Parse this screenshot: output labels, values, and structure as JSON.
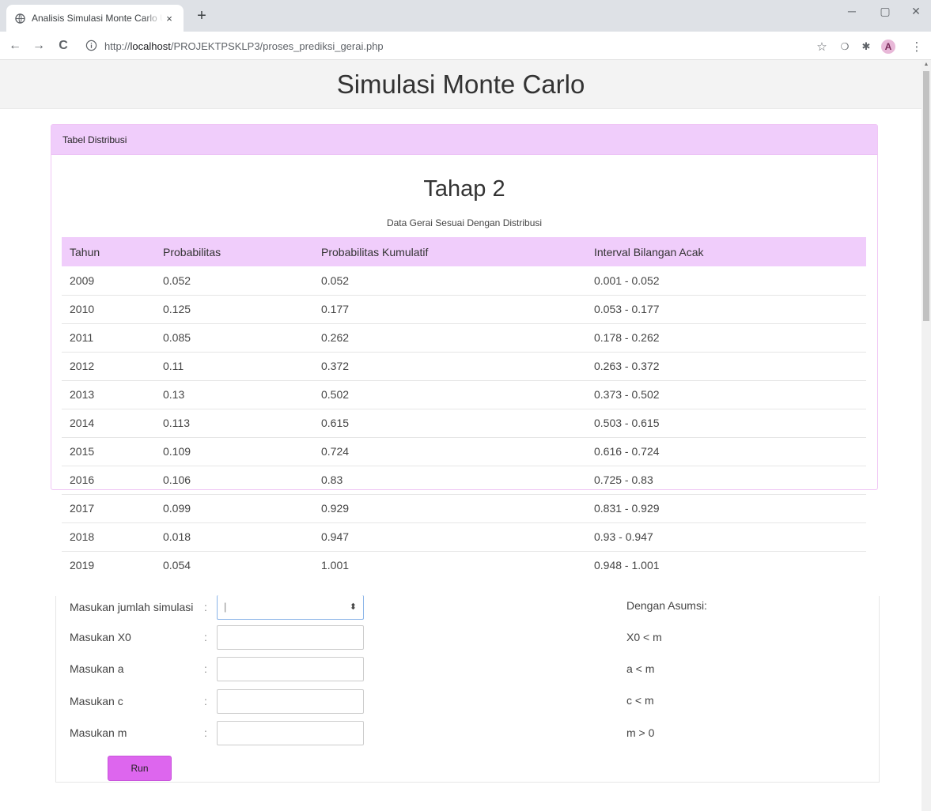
{
  "browser": {
    "tab_title": "Analisis Simulasi Monte Carlo Un",
    "url_prefix": "http://",
    "url_host": "localhost",
    "url_path": "/PROJEKTPSKLP3/proses_prediksi_gerai.php"
  },
  "header": {
    "title": "Simulasi Monte Carlo"
  },
  "card": {
    "header": "Tabel Distribusi"
  },
  "stage": {
    "title": "Tahap 2",
    "subtitle": "Data Gerai Sesuai Dengan Distribusi"
  },
  "table": {
    "columns": [
      "Tahun",
      "Probabilitas",
      "Probabilitas Kumulatif",
      "Interval Bilangan Acak"
    ],
    "rows": [
      [
        "2009",
        "0.052",
        "0.052",
        "0.001 - 0.052"
      ],
      [
        "2010",
        "0.125",
        "0.177",
        "0.053 - 0.177"
      ],
      [
        "2011",
        "0.085",
        "0.262",
        "0.178 - 0.262"
      ],
      [
        "2012",
        "0.11",
        "0.372",
        "0.263 - 0.372"
      ],
      [
        "2013",
        "0.13",
        "0.502",
        "0.373 - 0.502"
      ],
      [
        "2014",
        "0.113",
        "0.615",
        "0.503 - 0.615"
      ],
      [
        "2015",
        "0.109",
        "0.724",
        "0.616 - 0.724"
      ],
      [
        "2016",
        "0.106",
        "0.83",
        "0.725 - 0.83"
      ],
      [
        "2017",
        "0.099",
        "0.929",
        "0.831 - 0.929"
      ],
      [
        "2018",
        "0.018",
        "0.947",
        "0.93 - 0.947"
      ],
      [
        "2019",
        "0.054",
        "1.001",
        "0.948 - 1.001"
      ]
    ]
  },
  "form": {
    "fields": [
      {
        "label": "Masukan jumlah simulasi",
        "colon": ":",
        "value": "|"
      },
      {
        "label": "Masukan X0",
        "colon": ":",
        "value": ""
      },
      {
        "label": "Masukan a",
        "colon": ":",
        "value": ""
      },
      {
        "label": "Masukan c",
        "colon": ":",
        "value": ""
      },
      {
        "label": "Masukan m",
        "colon": ":",
        "value": ""
      }
    ],
    "assumptions_title": "Dengan Asumsi:",
    "assumptions": [
      "X0 < m",
      "a < m",
      "c < m",
      "m > 0"
    ],
    "run_label": "Run"
  },
  "icons": {
    "tab_close": "×",
    "new_tab": "+",
    "minimize": "─",
    "maximize": "▢",
    "close_window": "✕",
    "back": "←",
    "forward": "→",
    "reload": "C",
    "star": "☆",
    "extensions": "❍",
    "puzzle": "✱",
    "avatar": "A",
    "menu": "⋮",
    "spinner": "⬍"
  },
  "colors": {
    "accent": "#f0cdfb",
    "button": "#dd66ee"
  }
}
